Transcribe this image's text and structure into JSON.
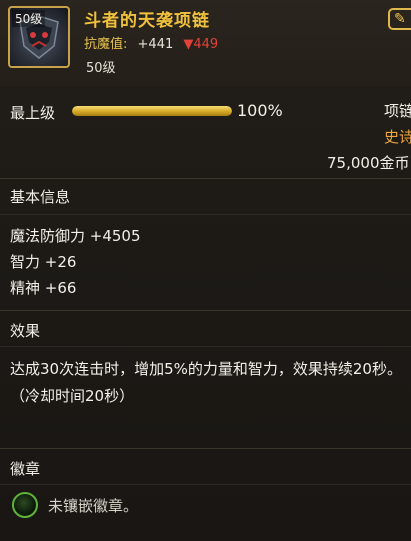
{
  "item": {
    "level_badge": "50级",
    "name": "斗者的天袭项链",
    "stat_label": "抗魔值:",
    "stat_plus": "+441",
    "stat_down": "▼449",
    "level_line": "50级",
    "corner_icon": "wrench-icon"
  },
  "upgrade": {
    "label": "最上级",
    "percent_text": "100%",
    "fill_percent": 100
  },
  "meta": {
    "type": "项链",
    "rarity": "史诗",
    "price": "75,000金币"
  },
  "basic": {
    "title": "基本信息",
    "lines": [
      "魔法防御力 +4505",
      "智力 +26",
      "精神 +66"
    ]
  },
  "effect": {
    "title": "效果",
    "text": "达成30次连击时，增加5%的力量和智力，效果持续20秒。（冷却时间20秒）"
  },
  "emblem": {
    "title": "徽章",
    "text": "未镶嵌徽章。"
  },
  "colors": {
    "gold": "#f0c13c",
    "rarity": "#f0a83a",
    "down": "#e3423a",
    "emblem_ring": "#5fb33b"
  }
}
